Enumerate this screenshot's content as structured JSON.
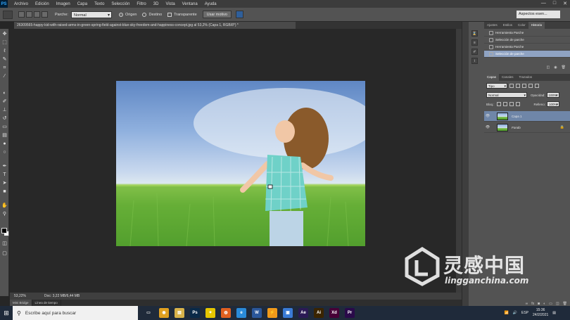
{
  "app": {
    "logo": "PS"
  },
  "menu": [
    "Archivo",
    "Edición",
    "Imagen",
    "Capa",
    "Texto",
    "Selección",
    "Filtro",
    "3D",
    "Vista",
    "Ventana",
    "Ayuda"
  ],
  "window_controls": [
    "—",
    "□",
    "✕"
  ],
  "options": {
    "parche_label": "Parche:",
    "parche_value": "Normal",
    "origen_label": "Origen",
    "destino_label": "Destino",
    "transparente_label": "Transparente",
    "usar_motivo_label": "Usar motivo",
    "workspace_value": "Aspectos esen..."
  },
  "document": {
    "tab_title": "26309565-happy-kid-with-raised-arms-in-green-spring-field-against-blue-sky-freedom-and-happiness-concept.jpg al 53,2% (Capa 1, RGB/8*) *"
  },
  "status": {
    "zoom": "53,22%",
    "doc": "Doc: 3,22 MB/6,44 MB"
  },
  "bridge_tabs": [
    "Mini Bridge",
    "Línea de tiempo"
  ],
  "history_panel": {
    "tabs": [
      "Ajustes",
      "Estilos",
      "Color",
      "Historia"
    ],
    "active_tab": "Historia",
    "items": [
      {
        "label": "Herramienta Parche",
        "selected": false
      },
      {
        "label": "Selección de parche",
        "selected": false
      },
      {
        "label": "Herramienta Parche",
        "selected": false
      },
      {
        "label": "Selección de parche",
        "selected": true
      }
    ]
  },
  "layers_panel": {
    "tabs": [
      "Capas",
      "Canales",
      "Trazados"
    ],
    "active_tab": "Capas",
    "filter_value": "Tipo",
    "blend_value": "Normal",
    "opacity_label": "Opacidad:",
    "opacity_value": "100%",
    "lock_label": "Bloq.:",
    "fill_label": "Relleno:",
    "fill_value": "100%",
    "layers": [
      {
        "name": "Capa 1",
        "selected": true
      },
      {
        "name": "Fondo",
        "selected": false
      }
    ]
  },
  "watermark": {
    "title": "灵感中国",
    "url": "lingganchina.com"
  },
  "taskbar": {
    "search_placeholder": "Escribe aquí para buscar",
    "apps": [
      {
        "name": "chrome",
        "label": "◉",
        "color": "#e0a020"
      },
      {
        "name": "explorer",
        "label": "▤",
        "color": "#d8b24a"
      },
      {
        "name": "photoshop",
        "label": "Ps",
        "color": "#0a2a48"
      },
      {
        "name": "lightbulb",
        "label": "✦",
        "color": "#e5c500"
      },
      {
        "name": "firefox",
        "label": "◍",
        "color": "#e06020"
      },
      {
        "name": "edge",
        "label": "e",
        "color": "#2a8ad8"
      },
      {
        "name": "word",
        "label": "W",
        "color": "#2b579a"
      },
      {
        "name": "bolt",
        "label": "⚡",
        "color": "#f09a1a"
      },
      {
        "name": "photos",
        "label": "▣",
        "color": "#3a7bd5"
      },
      {
        "name": "after-effects",
        "label": "Ae",
        "color": "#2b1a55"
      },
      {
        "name": "illustrator",
        "label": "Ai",
        "color": "#3a2400"
      },
      {
        "name": "xd",
        "label": "Xd",
        "color": "#470137"
      },
      {
        "name": "premiere",
        "label": "Pr",
        "color": "#2a0a4a"
      }
    ],
    "language": "ESP",
    "time": "15:36",
    "date": "24/2/2021"
  }
}
